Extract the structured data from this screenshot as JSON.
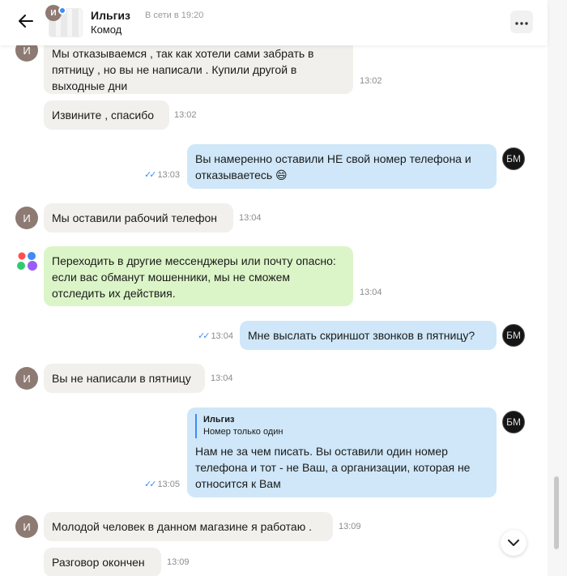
{
  "header": {
    "contact_name": "Ильгиз",
    "status": "В сети в 19:20",
    "subtitle": "Комод",
    "avatar_initial": "И"
  },
  "messages": [
    {
      "side": "in",
      "text": "Мы отказываемся , так как хотели сами забрать в пятницу , но вы не написали . Купили другой в выходные дни",
      "time": "13:02"
    },
    {
      "side": "in",
      "text": "Извините , спасибо",
      "time": "13:02"
    },
    {
      "side": "out",
      "text": "Вы намеренно оставили НЕ свой номер телефона и отказываетесь 😄",
      "time": "13:03",
      "avatar": "БМ"
    },
    {
      "side": "in",
      "text": "Мы оставили рабочий телефон",
      "time": "13:04",
      "avatar": "И"
    },
    {
      "side": "system",
      "text": "Переходить в другие мессенджеры или почту опасно: если вас обманут мошенники, мы не сможем отследить их действия.",
      "time": "13:04"
    },
    {
      "side": "out",
      "text": "Мне выслать скриншот звонков в пятницу?",
      "time": "13:04",
      "avatar": "БМ"
    },
    {
      "side": "in",
      "text": "Вы не написали в пятницу",
      "time": "13:04",
      "avatar": "И"
    },
    {
      "side": "out",
      "reply_name": "Ильгиз",
      "reply_text": "Номер только один",
      "text": "Нам не за чем писать.  Вы оставили один номер телефона и тот - не Ваш, а организации, которая не относится к Вам",
      "time": "13:05",
      "avatar": "БМ"
    },
    {
      "side": "in",
      "text": "Молодой человек в данном магазине я работаю .",
      "time": "13:09",
      "avatar": "И"
    },
    {
      "side": "in",
      "text": "Разговор окончен",
      "time": "13:09"
    }
  ],
  "read_ticks": "✓✓",
  "colors": {
    "incoming": "#f2f0ec",
    "outgoing": "#cfe7f8",
    "system": "#dcf5c8",
    "accent": "#3f8cf3",
    "avatar_in": "#8d7a73"
  },
  "icons": {
    "back": "arrow-left-icon",
    "more": "more-dots-icon",
    "scroll_down": "chevron-down-icon",
    "system": "brand-dots-icon"
  }
}
